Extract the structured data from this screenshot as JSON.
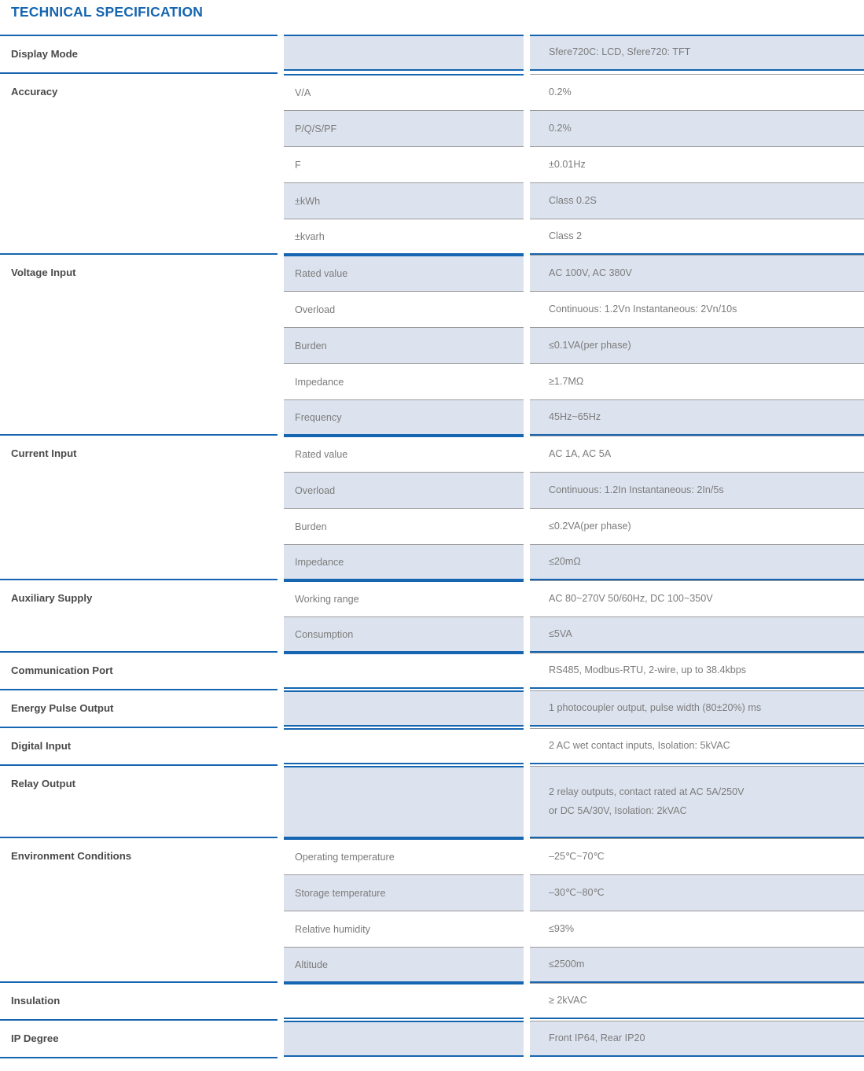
{
  "title": "TECHNICAL SPECIFICATION",
  "colors": {
    "accent_blue": "#1565b0",
    "label_gray": "#4a4a4a",
    "value_gray": "#7b7b7b",
    "shade_bg": "#dde3ee",
    "rule_gray": "#9a9a9a"
  },
  "sections": [
    {
      "category": "Display Mode",
      "rows": [
        {
          "sub": "",
          "value": "Sfere720C: LCD, Sfere720: TFT",
          "shaded": true
        }
      ]
    },
    {
      "category": "Accuracy",
      "rows": [
        {
          "sub": "V/A",
          "value": "0.2%",
          "shaded": false
        },
        {
          "sub": "P/Q/S/PF",
          "value": "0.2%",
          "shaded": true
        },
        {
          "sub": "F",
          "value": "±0.01Hz",
          "shaded": false
        },
        {
          "sub": "±kWh",
          "value": "Class 0.2S",
          "shaded": true
        },
        {
          "sub": "±kvarh",
          "value": "Class 2",
          "shaded": false
        }
      ]
    },
    {
      "category": "Voltage Input",
      "rows": [
        {
          "sub": "Rated value",
          "value": "AC 100V, AC 380V",
          "shaded": true
        },
        {
          "sub": "Overload",
          "value": "Continuous: 1.2Vn  Instantaneous: 2Vn/10s",
          "shaded": false
        },
        {
          "sub": "Burden",
          "value": "≤0.1VA(per phase)",
          "shaded": true
        },
        {
          "sub": "Impedance",
          "value": "≥1.7MΩ",
          "shaded": false
        },
        {
          "sub": "Frequency",
          "value": "45Hz~65Hz",
          "shaded": true
        }
      ]
    },
    {
      "category": "Current Input",
      "rows": [
        {
          "sub": "Rated value",
          "value": "AC 1A,  AC 5A",
          "shaded": false
        },
        {
          "sub": "Overload",
          "value": "Continuous: 1.2In  Instantaneous: 2In/5s",
          "shaded": true
        },
        {
          "sub": "Burden",
          "value": "≤0.2VA(per phase)",
          "shaded": false
        },
        {
          "sub": "Impedance",
          "value": "≤20mΩ",
          "shaded": true
        }
      ]
    },
    {
      "category": "Auxiliary Supply",
      "rows": [
        {
          "sub": "Working range",
          "value": "AC 80~270V 50/60Hz, DC 100~350V",
          "shaded": false
        },
        {
          "sub": "Consumption",
          "value": "≤5VA",
          "shaded": true
        }
      ]
    },
    {
      "category": "Communication Port",
      "rows": [
        {
          "sub": "",
          "value": " RS485, Modbus-RTU, 2-wire, up to 38.4kbps",
          "shaded": false
        }
      ]
    },
    {
      "category": "Energy Pulse Output",
      "rows": [
        {
          "sub": "",
          "value": "1 photocoupler output, pulse width (80±20%) ms",
          "shaded": true
        }
      ]
    },
    {
      "category": "Digital Input",
      "rows": [
        {
          "sub": "",
          "value": "2 AC wet contact inputs, Isolation: 5kVAC",
          "shaded": false
        }
      ]
    },
    {
      "category": "Relay Output",
      "rows": [
        {
          "sub": "",
          "value": "2 relay outputs, contact rated at AC 5A/250V",
          "value2": "or DC 5A/30V, Isolation: 2kVAC",
          "shaded": true,
          "tall": true
        }
      ]
    },
    {
      "category": "Environment Conditions",
      "rows": [
        {
          "sub": "Operating temperature",
          "value": "–25℃~70℃",
          "shaded": false
        },
        {
          "sub": "Storage temperature",
          "value": "–30℃~80℃",
          "shaded": true
        },
        {
          "sub": "Relative humidity",
          "value": "≤93%",
          "shaded": false
        },
        {
          "sub": "Altitude",
          "value": "≤2500m",
          "shaded": true
        }
      ]
    },
    {
      "category": "Insulation",
      "rows": [
        {
          "sub": "",
          "value": "≥ 2kVAC",
          "shaded": false
        }
      ]
    },
    {
      "category": "IP Degree",
      "rows": [
        {
          "sub": "",
          "value": "Front IP64, Rear IP20",
          "shaded": true
        }
      ]
    }
  ]
}
